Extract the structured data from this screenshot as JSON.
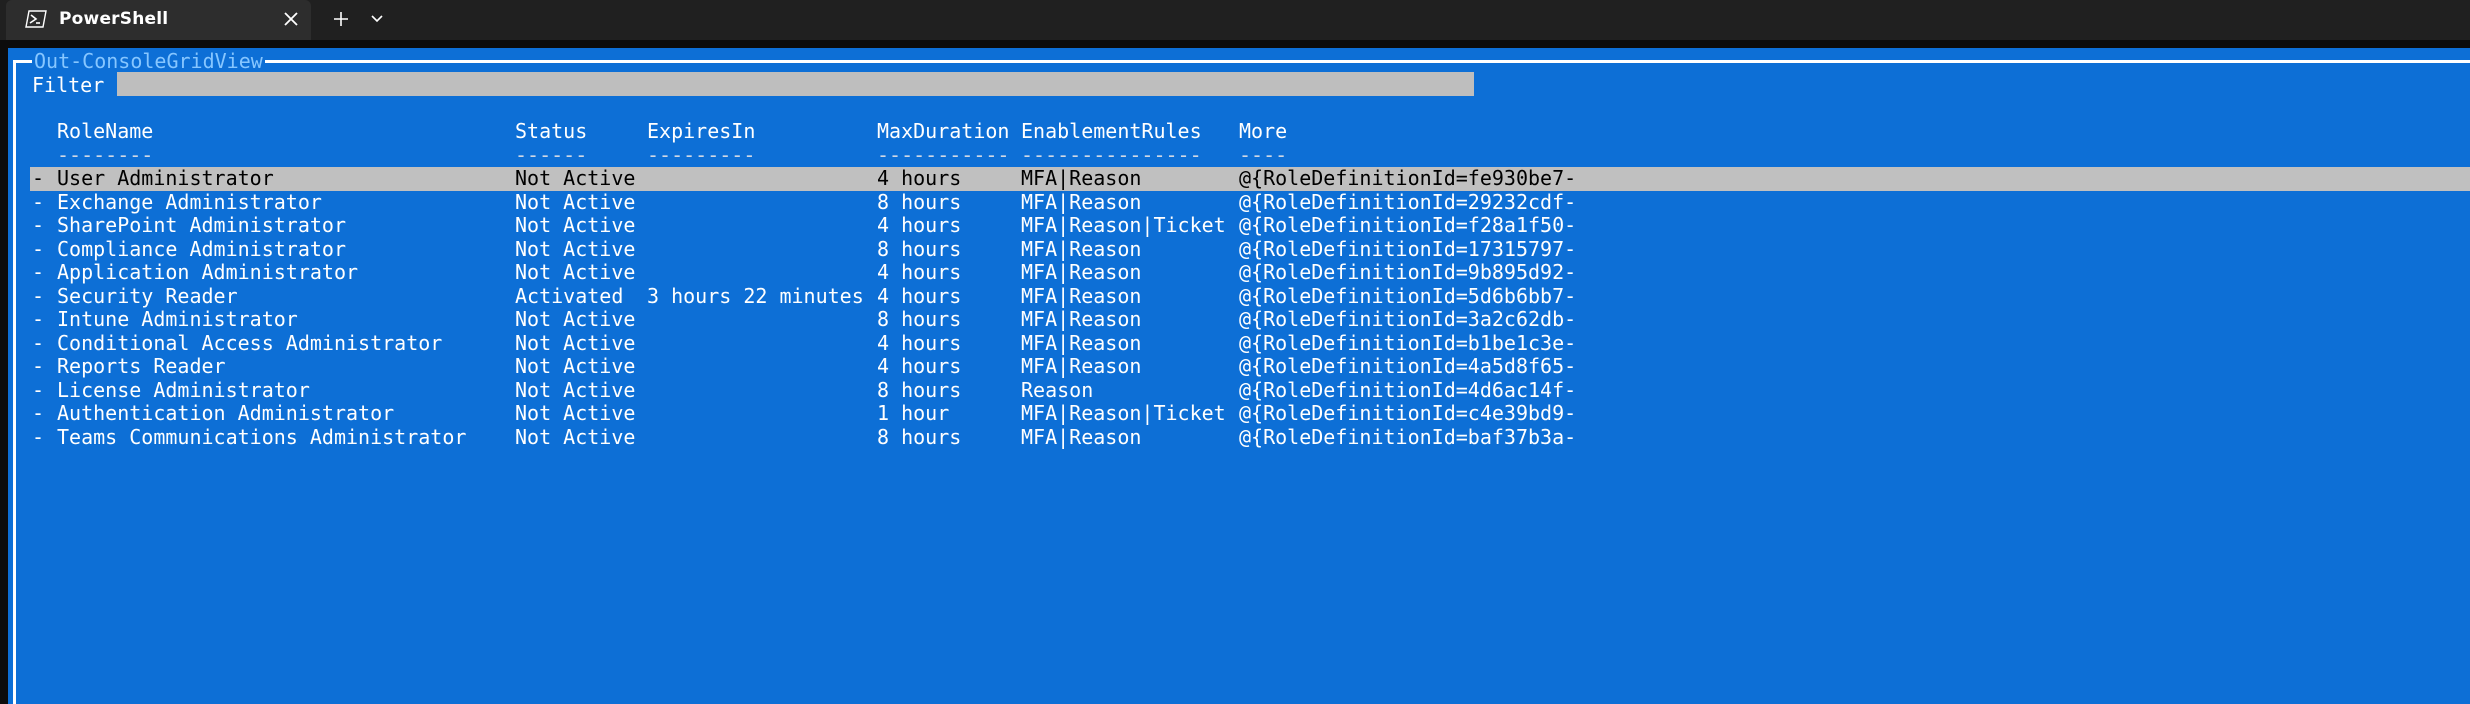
{
  "window": {
    "tab_title": "PowerShell",
    "tab_icon": "powershell-icon",
    "close_icon": "close-icon",
    "new_tab_icon": "plus-icon",
    "dropdown_icon": "chevron-down-icon"
  },
  "grid_view": {
    "title": "Out-ConsoleGridView",
    "filter_label": "Filter",
    "filter_value": "",
    "columns": [
      "RoleName",
      "Status",
      "ExpiresIn",
      "MaxDuration",
      "EnablementRules",
      "More"
    ],
    "underlines": [
      "--------",
      "------",
      "---------",
      "-----------",
      "---------------",
      "----"
    ],
    "rows": [
      {
        "mark": "-",
        "role": "User Administrator",
        "status": "Not Active",
        "expires": "",
        "max": "4 hours",
        "rules": "MFA|Reason",
        "more": "@{RoleDefinitionId=fe930be7-",
        "selected": true
      },
      {
        "mark": "-",
        "role": "Exchange Administrator",
        "status": "Not Active",
        "expires": "",
        "max": "8 hours",
        "rules": "MFA|Reason",
        "more": "@{RoleDefinitionId=29232cdf-",
        "selected": false
      },
      {
        "mark": "-",
        "role": "SharePoint Administrator",
        "status": "Not Active",
        "expires": "",
        "max": "4 hours",
        "rules": "MFA|Reason|Ticket",
        "more": "@{RoleDefinitionId=f28a1f50-",
        "selected": false
      },
      {
        "mark": "-",
        "role": "Compliance Administrator",
        "status": "Not Active",
        "expires": "",
        "max": "8 hours",
        "rules": "MFA|Reason",
        "more": "@{RoleDefinitionId=17315797-",
        "selected": false
      },
      {
        "mark": "-",
        "role": "Application Administrator",
        "status": "Not Active",
        "expires": "",
        "max": "4 hours",
        "rules": "MFA|Reason",
        "more": "@{RoleDefinitionId=9b895d92-",
        "selected": false
      },
      {
        "mark": "-",
        "role": "Security Reader",
        "status": "Activated",
        "expires": "3 hours 22 minutes",
        "max": "4 hours",
        "rules": "MFA|Reason",
        "more": "@{RoleDefinitionId=5d6b6bb7-",
        "selected": false
      },
      {
        "mark": "-",
        "role": "Intune Administrator",
        "status": "Not Active",
        "expires": "",
        "max": "8 hours",
        "rules": "MFA|Reason",
        "more": "@{RoleDefinitionId=3a2c62db-",
        "selected": false
      },
      {
        "mark": "-",
        "role": "Conditional Access Administrator",
        "status": "Not Active",
        "expires": "",
        "max": "4 hours",
        "rules": "MFA|Reason",
        "more": "@{RoleDefinitionId=b1be1c3e-",
        "selected": false
      },
      {
        "mark": "-",
        "role": "Reports Reader",
        "status": "Not Active",
        "expires": "",
        "max": "4 hours",
        "rules": "MFA|Reason",
        "more": "@{RoleDefinitionId=4a5d8f65-",
        "selected": false
      },
      {
        "mark": "-",
        "role": "License Administrator",
        "status": "Not Active",
        "expires": "",
        "max": "8 hours",
        "rules": "Reason",
        "more": "@{RoleDefinitionId=4d6ac14f-",
        "selected": false
      },
      {
        "mark": "-",
        "role": "Authentication Administrator",
        "status": "Not Active",
        "expires": "",
        "max": "1 hour",
        "rules": "MFA|Reason|Ticket",
        "more": "@{RoleDefinitionId=c4e39bd9-",
        "selected": false
      },
      {
        "mark": "-",
        "role": "Teams Communications Administrator",
        "status": "Not Active",
        "expires": "",
        "max": "8 hours",
        "rules": "MFA|Reason",
        "more": "@{RoleDefinitionId=baf37b3a-",
        "selected": false
      }
    ]
  },
  "colors": {
    "panel_bg": "#0d6fd6",
    "selected_row_bg": "#c0c0c0",
    "title_text": "#86c6ff"
  }
}
